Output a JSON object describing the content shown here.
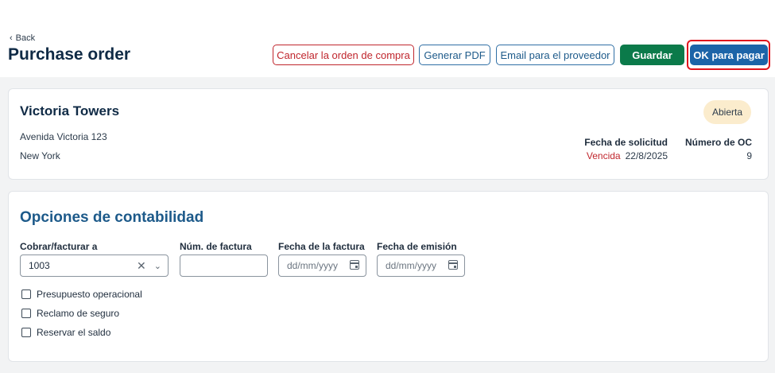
{
  "header": {
    "back_label": "Back",
    "title": "Purchase order",
    "buttons": {
      "cancel": "Cancelar la orden de compra",
      "pdf": "Generar PDF",
      "email": "Email para el proveedor",
      "save": "Guardar",
      "ok": "OK para pagar"
    }
  },
  "vendor": {
    "name": "Victoria Towers",
    "address_line1": "Avenida Victoria 123",
    "address_line2": "New York",
    "status": "Abierta",
    "request_date_label": "Fecha de solicitud",
    "request_date_status": "Vencida",
    "request_date": "22/8/2025",
    "po_number_label": "Número de OC",
    "po_number": "9"
  },
  "accounting": {
    "title": "Opciones de contabilidad",
    "bill_to_label": "Cobrar/facturar a",
    "bill_to_value": "1003",
    "invoice_number_label": "Núm. de factura",
    "invoice_number_value": "",
    "invoice_date_label": "Fecha de la factura",
    "invoice_date_placeholder": "dd/mm/yyyy",
    "issue_date_label": "Fecha de emisión",
    "issue_date_placeholder": "dd/mm/yyyy",
    "checkboxes": [
      {
        "label": "Presupuesto operacional",
        "checked": false
      },
      {
        "label": "Reclamo de seguro",
        "checked": false
      },
      {
        "label": "Reservar el saldo",
        "checked": false
      }
    ]
  },
  "colors": {
    "primary": "#1c64a8",
    "save": "#0b7a4a",
    "danger": "#c0262d",
    "highlight": "#e0151d",
    "badge_bg": "#fbeccd"
  }
}
